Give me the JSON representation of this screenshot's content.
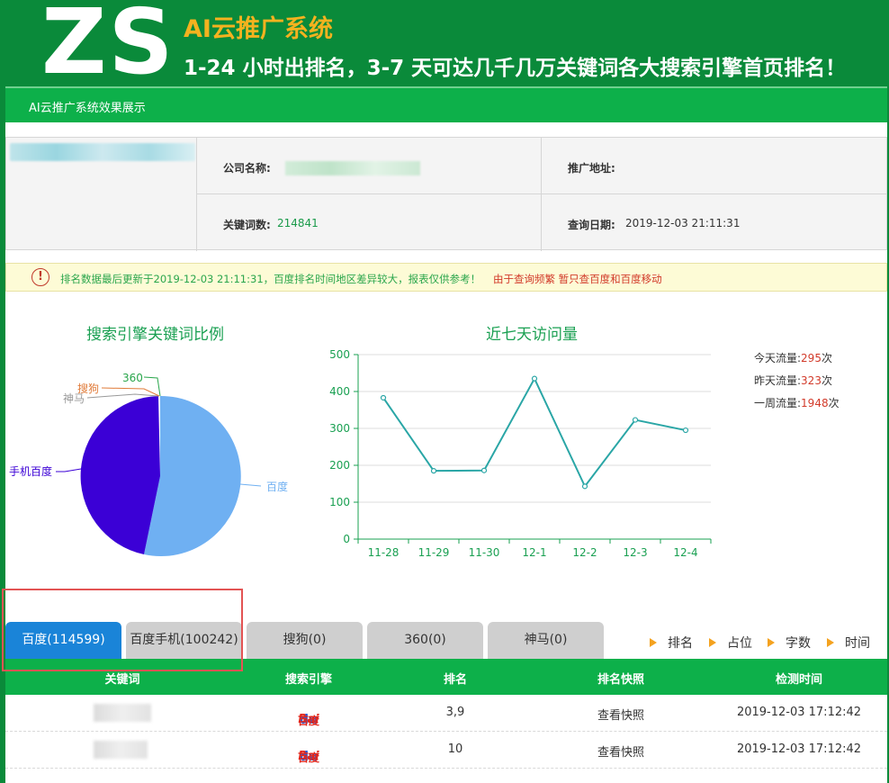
{
  "header": {
    "logo": "ZS",
    "brand": "AI云推广系统",
    "slogan": "1-24 小时出排名，3-7 天可达几千几万关键词各大搜索引擎首页排名！"
  },
  "nav": {
    "title": "AI云推广系统效果展示"
  },
  "info": {
    "company_label": "公司名称:",
    "address_label": "推广地址:",
    "keywords_label": "关键词数:",
    "keywords_value": "214841",
    "date_label": "查询日期:",
    "date_value": "2019-12-03 21:11:31"
  },
  "notice": {
    "icon": "exclamation-circle-icon",
    "text": "排名数据最后更新于2019-12-03 21:11:31，百度排名时间地区差异较大，报表仅供参考！",
    "warning": "由于查询频繁 暂只查百度和百度移动"
  },
  "pie": {
    "title": "搜索引擎关键词比例",
    "labels": {
      "baidu": "百度",
      "mobile": "手机百度",
      "shenma": "神马",
      "sogou": "搜狗",
      "s360": "360"
    },
    "colors": {
      "baidu": "#6fb0f2",
      "mobile": "#3b00d6",
      "shenma": "#999999",
      "sogou": "#e07b39",
      "s360": "#2aa64c"
    }
  },
  "chart_data": {
    "type": "line",
    "title": "近七天访问量",
    "categories": [
      "11-28",
      "11-29",
      "11-30",
      "12-1",
      "12-2",
      "12-3",
      "12-4"
    ],
    "values": [
      383,
      185,
      186,
      435,
      143,
      323,
      295
    ],
    "ylim": [
      0,
      500
    ],
    "yticks": [
      0,
      100,
      200,
      300,
      400,
      500
    ],
    "color": "#2aa6a6"
  },
  "stats": {
    "today_label": "今天流量:",
    "today_value": "295",
    "unit": "次",
    "yesterday_label": "昨天流量:",
    "yesterday_value": "323",
    "week_label": "一周流量:",
    "week_value": "1948"
  },
  "tabs": [
    "百度(114599)",
    "百度手机(100242)",
    "搜狗(0)",
    "360(0)",
    "神马(0)"
  ],
  "sorts": [
    "排名",
    "占位",
    "字数",
    "时间"
  ],
  "table": {
    "headers": [
      "关键词",
      "搜索引擎",
      "排名",
      "排名快照",
      "检测时间"
    ],
    "rows": [
      {
        "rank": "3,9",
        "snapshot": "查看快照",
        "time": "2019-12-03 17:12:42"
      },
      {
        "rank": "10",
        "snapshot": "查看快照",
        "time": "2019-12-03 17:12:42"
      }
    ],
    "engine_logo": {
      "bai": "Bai",
      "paw": "du",
      "cn": "百度"
    }
  }
}
